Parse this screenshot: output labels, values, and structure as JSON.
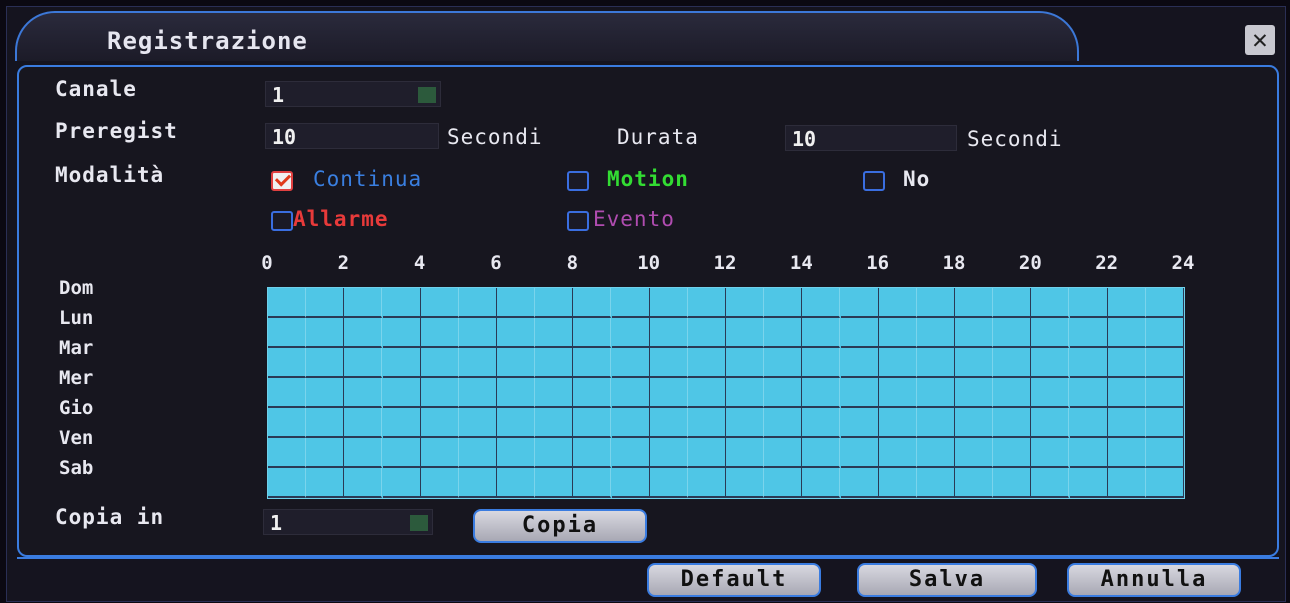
{
  "window": {
    "title": "Registrazione",
    "close_label": "✕"
  },
  "canale": {
    "label": "Canale",
    "value": "1"
  },
  "preregist": {
    "label": "Preregist",
    "value": "10",
    "unit": "Secondi"
  },
  "durata": {
    "label": "Durata",
    "value": "10",
    "unit": "Secondi"
  },
  "modalita": {
    "label": "Modalità",
    "options": [
      {
        "label": "Continua",
        "checked": true,
        "color": "#3a7fe0"
      },
      {
        "label": "Motion",
        "checked": false,
        "color": "#33dd33"
      },
      {
        "label": "No",
        "checked": false,
        "color": "#e8e8f0"
      },
      {
        "label": "Allarme",
        "checked": false,
        "color": "#e83a3a"
      },
      {
        "label": "Evento",
        "checked": false,
        "color": "#b04cb0"
      }
    ]
  },
  "schedule": {
    "hours": [
      "0",
      "2",
      "4",
      "6",
      "8",
      "10",
      "12",
      "14",
      "16",
      "18",
      "20",
      "22",
      "24"
    ],
    "days": [
      "Dom",
      "Lun",
      "Mar",
      "Mer",
      "Gio",
      "Ven",
      "Sab"
    ],
    "fill_color": "#4fc6e6"
  },
  "copia_in": {
    "label": "Copia in",
    "value": "1"
  },
  "buttons": {
    "copia": "Copia",
    "default": "Default",
    "salva": "Salva",
    "annulla": "Annulla"
  }
}
